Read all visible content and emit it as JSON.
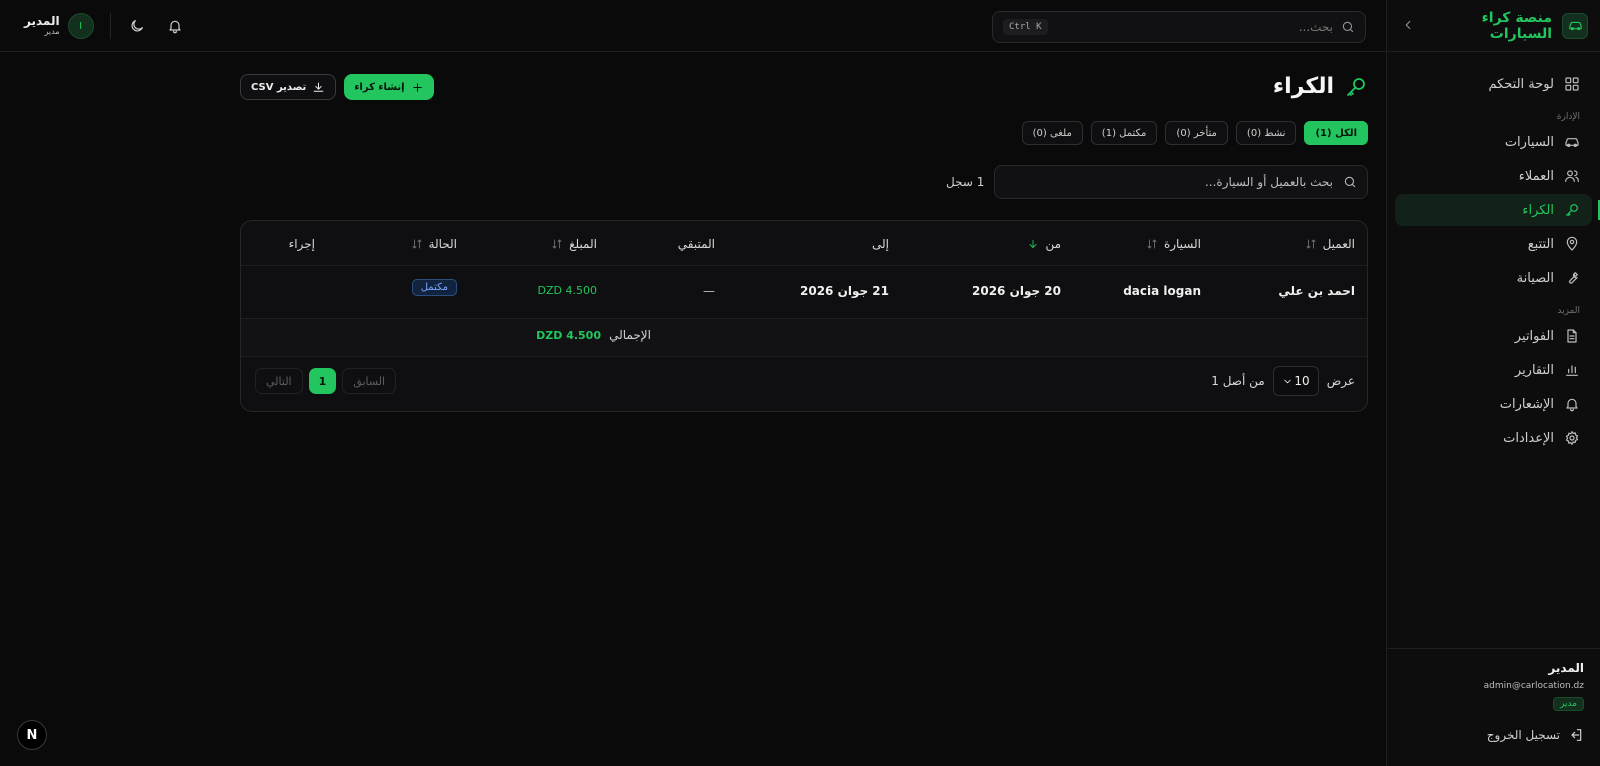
{
  "app": {
    "title": "منصة كراء السيارات"
  },
  "sidebar": {
    "dashboard": "لوحة التحكم",
    "section_admin": "الإدارة",
    "items": [
      {
        "label": "السيارات",
        "icon": "car-icon"
      },
      {
        "label": "العملاء",
        "icon": "users-icon"
      },
      {
        "label": "الكراء",
        "icon": "key-icon",
        "active": true
      },
      {
        "label": "التتبع",
        "icon": "map-pin-icon"
      },
      {
        "label": "الصيانة",
        "icon": "wrench-icon"
      }
    ],
    "section_more": "المزيد",
    "more_items": [
      {
        "label": "الفواتير",
        "icon": "file-icon"
      },
      {
        "label": "التقارير",
        "icon": "bar-chart-icon"
      },
      {
        "label": "الإشعارات",
        "icon": "bell-icon"
      },
      {
        "label": "الإعدادات",
        "icon": "gear-icon"
      }
    ],
    "user": {
      "name": "المدير",
      "email": "admin@carlocation.dz",
      "role": "مدير"
    },
    "logout": "تسجيل الخروج"
  },
  "topbar": {
    "search_placeholder": "بحث...",
    "shortcut": "Ctrl K",
    "user_name": "المدير",
    "user_role": "مدير",
    "avatar_initial": "I"
  },
  "page": {
    "title": "الكراء",
    "create_button": "إنشاء كراء",
    "export_button": "تصدير CSV",
    "filters": [
      {
        "label": "الكل (1)",
        "active": true
      },
      {
        "label": "نشط (0)"
      },
      {
        "label": "متأخر (0)"
      },
      {
        "label": "مكتمل (1)"
      },
      {
        "label": "ملغى (0)"
      }
    ],
    "table_search_placeholder": "بحث بالعميل أو السيارة...",
    "record_count": "1 سجل"
  },
  "table": {
    "headers": {
      "client": "العميل",
      "car": "السيارة",
      "from": "من",
      "to": "إلى",
      "remaining": "المتبقي",
      "amount": "المبلغ",
      "status": "الحالة",
      "action": "إجراء"
    },
    "rows": [
      {
        "client": "احمد بن علي",
        "car": "dacia logan",
        "from": "20 جوان 2026",
        "to": "21 جوان 2026",
        "remaining": "—",
        "amount": "DZD 4.500",
        "status": "مكتمل"
      }
    ],
    "total_label": "الإجمالي",
    "total_value": "DZD 4.500"
  },
  "pagination": {
    "show_label": "عرض",
    "per_page": "10",
    "of_label": "من أصل 1",
    "prev": "السابق",
    "current": "1",
    "next": "التالي"
  },
  "dev_badge": "N",
  "colors": {
    "accent": "#22c55e",
    "background": "#0a0a0b",
    "status_completed": "#79a8ff"
  }
}
